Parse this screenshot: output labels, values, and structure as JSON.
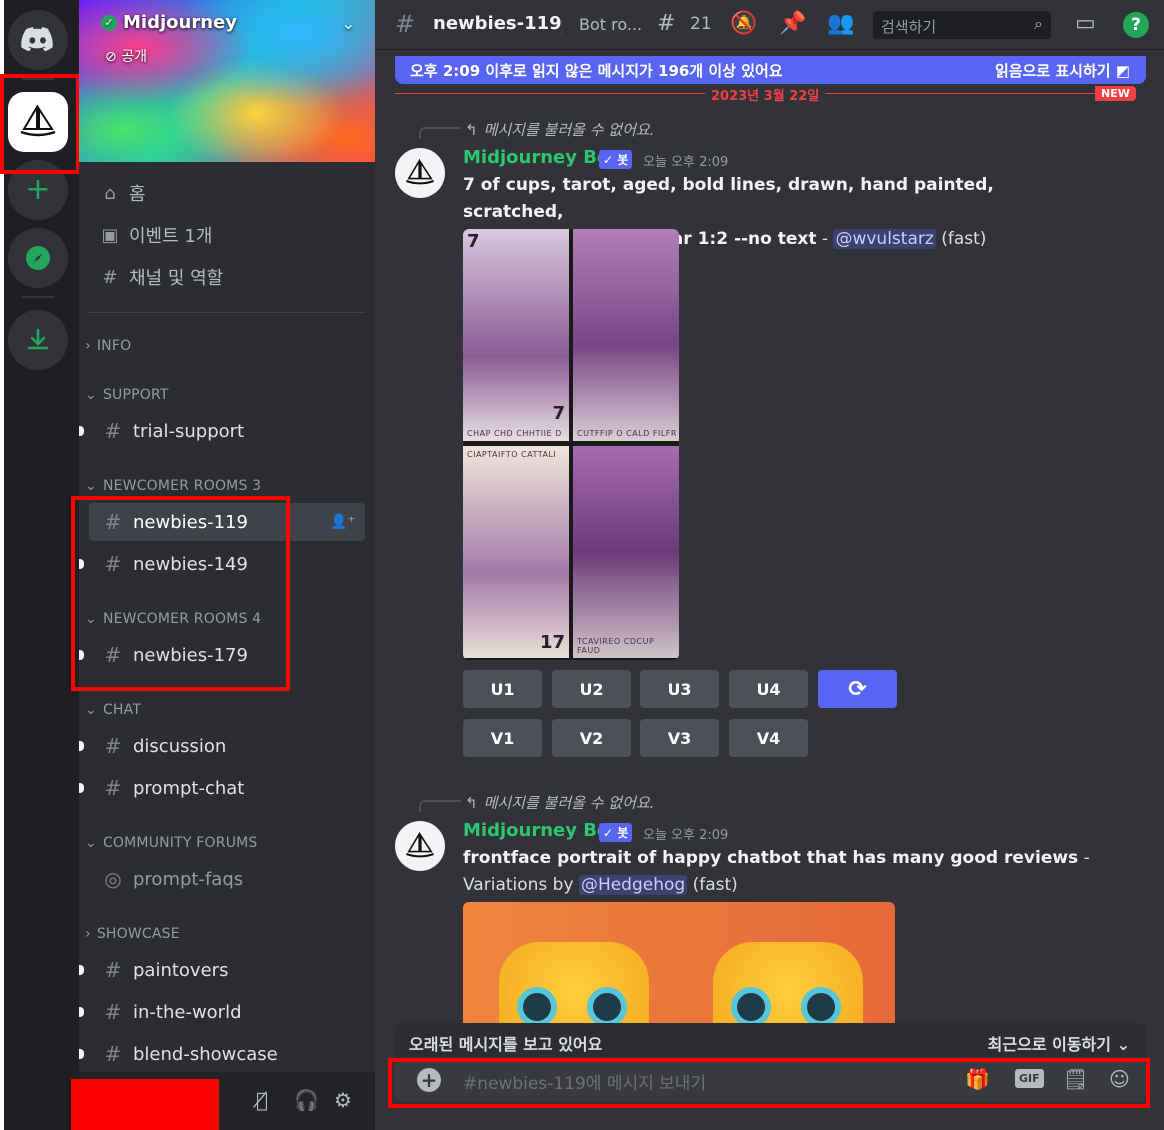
{
  "server": {
    "name": "Midjourney",
    "visibility": "공개"
  },
  "nav": {
    "home": "홈",
    "events": "이벤트 1개",
    "channels_roles": "채널 및 역할"
  },
  "categories": {
    "info": "INFO",
    "support": "SUPPORT",
    "newcomer3": "NEWCOMER ROOMS 3",
    "newcomer4": "NEWCOMER ROOMS 4",
    "chat": "CHAT",
    "forums": "COMMUNITY FORUMS",
    "showcase": "SHOWCASE"
  },
  "channels": {
    "trial_support": "trial-support",
    "newbies_119": "newbies-119",
    "newbies_149": "newbies-149",
    "newbies_179": "newbies-179",
    "discussion": "discussion",
    "prompt_chat": "prompt-chat",
    "prompt_faqs": "prompt-faqs",
    "paintovers": "paintovers",
    "in_the_world": "in-the-world",
    "blend_showcase": "blend-showcase"
  },
  "topbar": {
    "channel": "newbies-119",
    "topic": "Bot ro...",
    "thread_count": "21",
    "search_placeholder": "검색하기"
  },
  "unread_banner": {
    "text": "오후 2:09 이후로 읽지 않은 메시지가 196개 이상 있어요",
    "action": "읽음으로 표시하기"
  },
  "divider": {
    "date": "2023년 3월 22일",
    "new_label": "NEW"
  },
  "messages": [
    {
      "reply": "메시지를 불러올 수 없어요.",
      "author": "Midjourney Bot",
      "bot_tag": "✓ 봇",
      "timestamp": "오늘 오후 2:09",
      "prompt_line1": "7 of cups, tarot, aged, bold lines, drawn, hand painted, scratched,",
      "prompt_line2": "faded, purple tones --ar 1:2 --no text",
      "dash": " - ",
      "mention": "@wvulstarz",
      "mode": " (fast)",
      "image_captions": [
        "CHAP CHD CHHTIIE D",
        "CUTFFIP O CALD FILFR",
        "CIAPTAIFTO CATTALI",
        "TCAVIREO CDCUP FAUD"
      ],
      "image_numbers": [
        "7",
        "7",
        "17"
      ]
    },
    {
      "reply": "메시지를 불러올 수 없어요.",
      "author": "Midjourney Bot",
      "bot_tag": "✓ 봇",
      "timestamp": "오늘 오후 2:09",
      "prompt": "frontface portrait of happy chatbot that has many good reviews",
      "dash": " -",
      "variations": "Variations by ",
      "mention": "@Hedgehog",
      "mode": " (fast)"
    }
  ],
  "buttons": {
    "u": [
      "U1",
      "U2",
      "U3",
      "U4"
    ],
    "v": [
      "V1",
      "V2",
      "V3",
      "V4"
    ],
    "reroll_icon": "refresh-icon"
  },
  "old_bar": {
    "text": "오래된 메시지를 보고 있어요",
    "jump": "최근으로 이동하기"
  },
  "composer": {
    "placeholder": "#newbies-119에 메시지 보내기",
    "gif": "GIF"
  },
  "colors": {
    "blurple": "#5865f2",
    "green": "#23a55a",
    "red": "#f23f43",
    "highlight": "#ff0000"
  }
}
